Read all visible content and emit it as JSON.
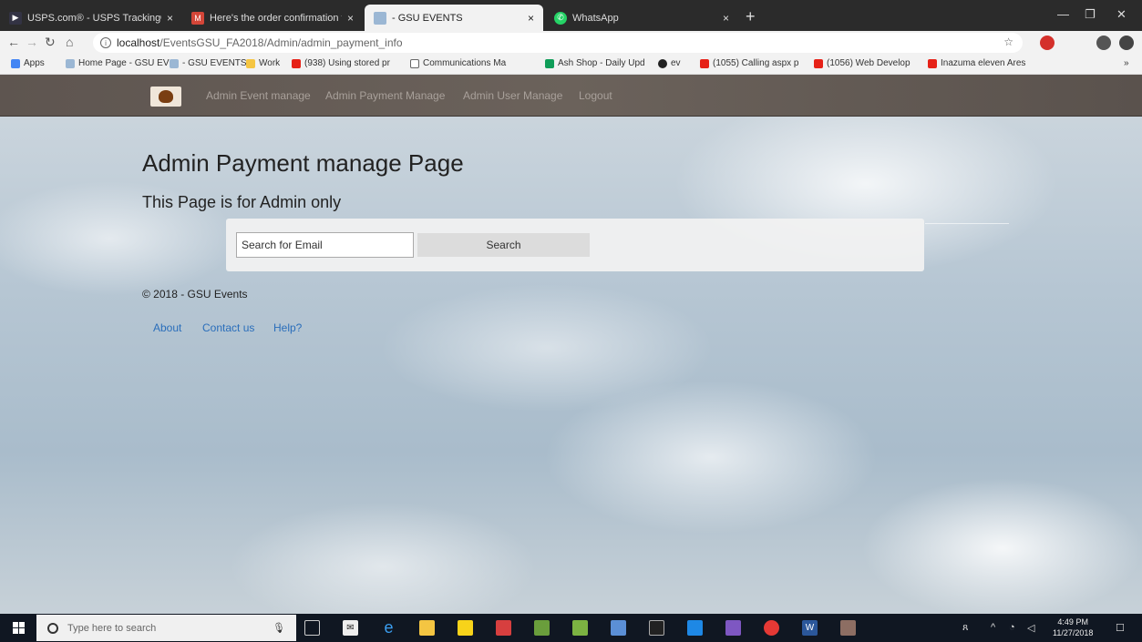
{
  "browser": {
    "tabs": [
      {
        "title": "USPS.com® - USPS Tracking® Re",
        "active": false,
        "icon": "usps-icon"
      },
      {
        "title": "Here's the order confirmation fo",
        "active": false,
        "icon": "gmail-icon"
      },
      {
        "title": "- GSU EVENTS",
        "active": true,
        "icon": "page-icon"
      },
      {
        "title": "WhatsApp",
        "active": false,
        "icon": "whatsapp-icon"
      }
    ],
    "url_host": "localhost",
    "url_path": "/EventsGSU_FA2018/Admin/admin_payment_info",
    "bookmarks": [
      {
        "label": "Apps",
        "icon": "apps-icon",
        "color": "#4285f4"
      },
      {
        "label": "Home Page - GSU EV",
        "icon": "page-icon",
        "color": "#9bb7d4"
      },
      {
        "label": "- GSU EVENTS",
        "icon": "page-icon",
        "color": "#9bb7d4"
      },
      {
        "label": "Work",
        "icon": "folder-icon",
        "color": "#f5c542"
      },
      {
        "label": "(938) Using stored pr",
        "icon": "youtube-icon",
        "color": "#e62117"
      },
      {
        "label": "Communications Ma",
        "icon": "doc-icon",
        "color": "#ffffff"
      },
      {
        "label": "Ash Shop - Daily Upd",
        "icon": "sheets-icon",
        "color": "#0f9d58"
      },
      {
        "label": "ev",
        "icon": "github-icon",
        "color": "#222222"
      },
      {
        "label": "(1055) Calling aspx p",
        "icon": "youtube-icon",
        "color": "#e62117"
      },
      {
        "label": "(1056) Web Develop",
        "icon": "youtube-icon",
        "color": "#e62117"
      },
      {
        "label": "Inazuma eleven Ares",
        "icon": "youtube-icon",
        "color": "#e62117"
      }
    ],
    "more_bookmarks": "»"
  },
  "site": {
    "nav": [
      "Admin Event manage",
      "Admin Payment Manage",
      "Admin User Manage",
      "Logout"
    ],
    "title": "Admin Payment manage Page",
    "subtitle": "This Page is for Admin only",
    "search_placeholder": "Search for Email",
    "search_button": "Search",
    "copyright": "© 2018 - GSU Events",
    "footer_links": [
      "About",
      "Contact us",
      "Help?"
    ]
  },
  "taskbar": {
    "search_placeholder": "Type here to search",
    "time": "4:49 PM",
    "date": "11/27/2018"
  }
}
